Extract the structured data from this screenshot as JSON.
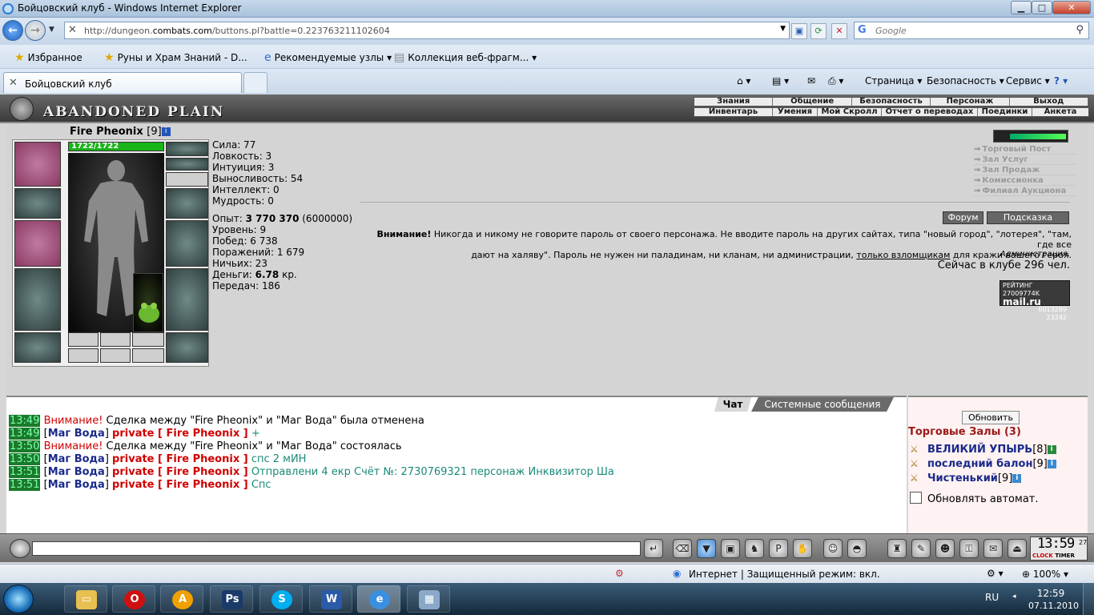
{
  "window": {
    "title": "Бойцовский клуб - Windows Internet Explorer"
  },
  "address": {
    "url_prefix": "http://dungeon.",
    "url_domain": "combats.com",
    "url_suffix": "/buttons.pl?battle=0.223763211102604",
    "search_placeholder": "Google"
  },
  "favorites": {
    "favs_label": "Избранное",
    "items": [
      "Руны и Храм Знаний - D...",
      "Рекомендуемые узлы ▾",
      "Коллекция веб-фрагм... ▾"
    ]
  },
  "tabs": {
    "active": "Бойцовский клуб"
  },
  "commandbar": {
    "page": "Страница ▾",
    "security": "Безопасность ▾",
    "service": "Сервис ▾"
  },
  "game": {
    "logo": "ABANDONED PLAIN",
    "menu_top": [
      "Знания",
      "Общение",
      "Безопасность",
      "Персонаж",
      "Выход"
    ],
    "menu_bottom": [
      "Инвентарь",
      "Умения",
      "Мой Скролл",
      "Отчет о переводах",
      "Поединки",
      "Анкета"
    ],
    "player": {
      "name": "Fire Pheonix",
      "level": "[9]",
      "hp_text": "1722/1722",
      "hp_fraction": 1.0
    },
    "stats": {
      "strength": "Сила: 77",
      "agility": "Ловкость: 3",
      "intuition": "Интуиция: 3",
      "endurance": "Выносливость: 54",
      "intellect": "Интеллект: 0",
      "wisdom": "Мудрость: 0",
      "exp_label": "Опыт: ",
      "exp_value": "3 770 370",
      "exp_next": " (6000000)",
      "level": "Уровень: 9",
      "wins": "Побед: 6 738",
      "losses": "Поражений: 1 679",
      "draws": "Ничьих: 23",
      "money_label": "Деньги: ",
      "money_value": "6.78",
      "money_unit": " кр.",
      "transfers": "Передач: 186"
    },
    "rightlinks": [
      "Торговый Пост",
      "Зал Услуг",
      "Зал Продаж",
      "Комиссионка",
      "Филиал Аукциона"
    ],
    "forum_btn": "Форум",
    "hint_btn": "Подсказка",
    "warning_bold": "Внимание!",
    "warning_text1": " Никогда и никому не говорите пароль от своего персонажа. Не вводите пароль на других сайтах, типа \"новый город\", \"лотерея\", \"там, где все",
    "warning_text2": "дают на халяву\". Пароль не нужен ни паладинам, ни кланам, ни администрации, ",
    "warning_link": "только взломщикам",
    "warning_text3": " для кражи вашего героя.",
    "admin": "Администрация.",
    "online": "Сейчас в клубе 296 чел.",
    "rating_l1": "РЕЙТИНГ 27009774K",
    "rating_brand": "mail.ru",
    "rating_l2": "6013289",
    "rating_l3": "23242"
  },
  "chat": {
    "tab_chat": "Чат",
    "tab_system": "Системные сообщения",
    "lines": [
      {
        "time": "13:49",
        "warn": "Внимание!",
        "text": " Сделка между \"Fire Pheonix\" и \"Маг Вода\" была отменена"
      },
      {
        "time": "13:49",
        "name": "Маг Вода",
        "private": "private [ Fire Pheonix ]",
        "msg": " +"
      },
      {
        "time": "13:50",
        "warn": "Внимание!",
        "text": " Сделка между \"Fire Pheonix\" и \"Маг Вода\" состоялась"
      },
      {
        "time": "13:50",
        "name": "Маг Вода",
        "private": "private [ Fire Pheonix ]",
        "msg": " спс 2 мИН"
      },
      {
        "time": "13:51",
        "name": "Маг Вода",
        "private": "private [ Fire Pheonix ]",
        "msg": " Отправлени 4 екр Счёт №: 2730769321 персонаж Инквизитор Ша"
      },
      {
        "time": "13:51",
        "name": "Маг Вода",
        "private": "private [ Fire Pheonix ]",
        "msg": " Спс"
      }
    ]
  },
  "side": {
    "refresh_btn": "Обновить",
    "title": "Торговые Залы (3)",
    "players": [
      {
        "name": "ВЕЛИКИЙ УПЫРЬ",
        "lvl": "[8]"
      },
      {
        "name": "последний балон",
        "lvl": "[9]"
      },
      {
        "name": "Чистенький",
        "lvl": "[9]"
      }
    ],
    "auto_label": "Обновлять автомат."
  },
  "clock": {
    "time": "13:59",
    "sec": "27",
    "lbl_clock": "CLOCK",
    "lbl_timer": "TIMER"
  },
  "statusbar": {
    "zone": "Интернет | Защищенный режим: вкл.",
    "zoom": "100%"
  },
  "taskbar": {
    "lang": "RU",
    "time": "12:59",
    "date": "07.11.2010"
  }
}
